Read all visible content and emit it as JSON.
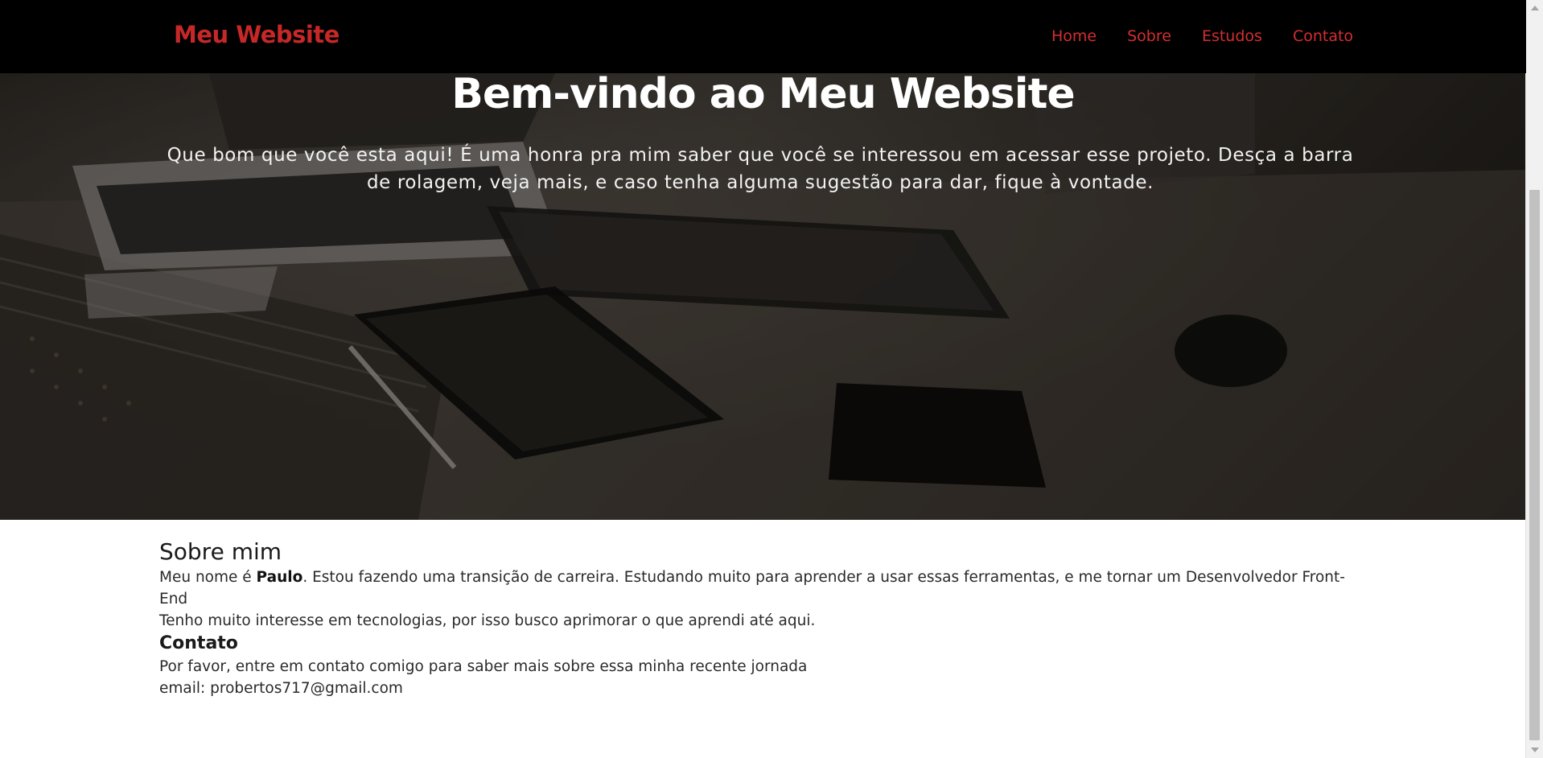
{
  "colors": {
    "brand": "#c62828",
    "nav_link": "#d32f2f",
    "navbar_bg": "#000000"
  },
  "navbar": {
    "brand": "Meu Website",
    "links": [
      "Home",
      "Sobre",
      "Estudos",
      "Contato"
    ]
  },
  "hero": {
    "title": "Bem-vindo ao Meu Website",
    "text": "Que bom que você esta aqui! É uma honra pra mim saber que você se interessou em acessar esse projeto. Desça a barra de rolagem, veja mais, e caso tenha alguma sugestão para dar, fique à vontade.",
    "background_image": "laptop-keyboard-tablet-desk-photo"
  },
  "about": {
    "title": "Sobre mim",
    "line1_prefix": "Meu nome é ",
    "line1_name": "Paulo",
    "line1_suffix": ". Estou fazendo uma transição de carreira. Estudando muito para aprender a usar essas ferramentas, e me tornar um Desenvolvedor Front-End",
    "line2": "Tenho muito interesse em tecnologias, por isso busco aprimorar o que aprendi até aqui."
  },
  "contact": {
    "title": "Contato",
    "line1": "Por favor, entre em contato comigo para saber mais sobre essa minha recente jornada",
    "email_line": "email: probertos717@gmail.com"
  }
}
